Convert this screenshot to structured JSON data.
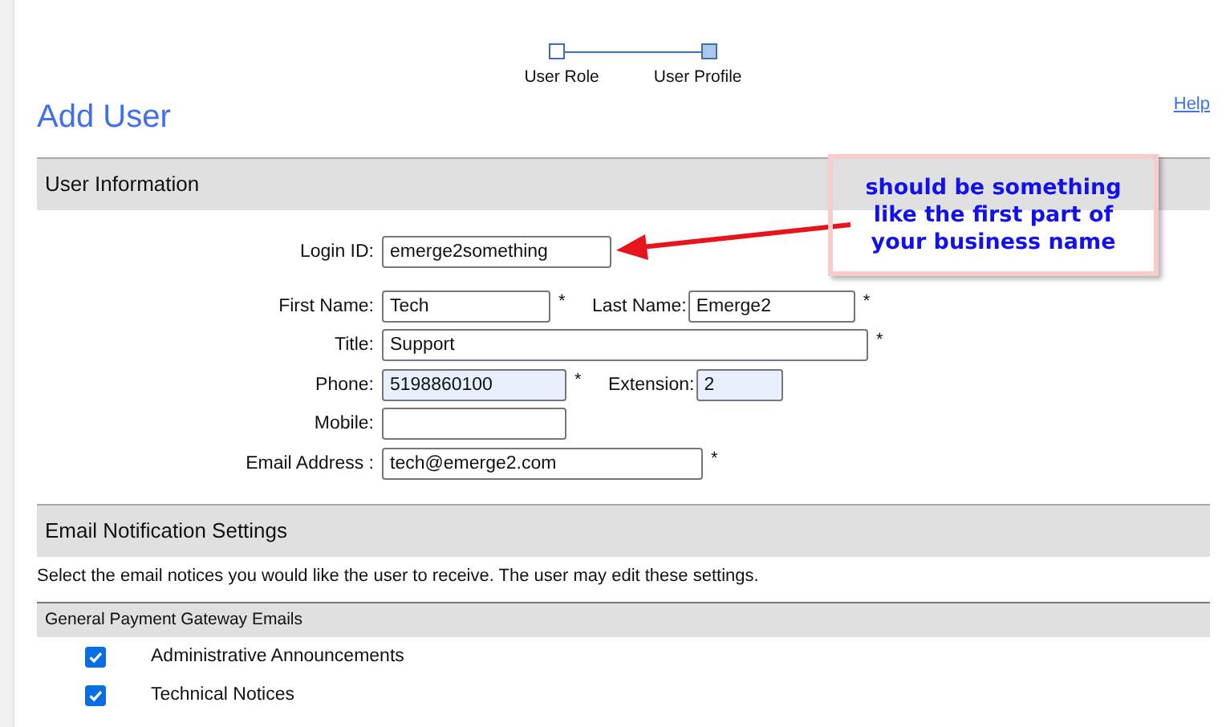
{
  "stepper": {
    "steps": [
      {
        "label": "User Role",
        "selected": false
      },
      {
        "label": "User Profile",
        "selected": true
      }
    ]
  },
  "title": "Add User",
  "help": "Help",
  "user_information": {
    "heading": "User Information",
    "rows": [
      [
        {
          "label": "Login ID:",
          "value": "emerge2something",
          "autofilled": false
        }
      ],
      [
        {
          "label": "First Name:",
          "value": "Tech",
          "required_mark": "*",
          "autofilled": false
        },
        {
          "label": "Last Name:",
          "value": "Emerge2",
          "required_mark": "*",
          "autofilled": false
        }
      ],
      [
        {
          "label": "Title:",
          "value": "Support",
          "required_mark": "*",
          "autofilled": false
        }
      ],
      [
        {
          "label": "Phone:",
          "value": "5198860100",
          "required_mark": "*",
          "autofilled": true
        },
        {
          "label": "Extension:",
          "value": "2",
          "autofilled": true
        }
      ],
      [
        {
          "label": "Mobile:",
          "autofilled": false
        }
      ],
      [
        {
          "label": "Email Address :",
          "value": "tech@emerge2.com",
          "required_mark": "*",
          "autofilled": false
        }
      ]
    ]
  },
  "email_notifications": {
    "heading": "Email Notification Settings",
    "description": "Select the email notices you would like the user to receive. The user may edit these settings.",
    "group": {
      "heading": "General Payment Gateway Emails",
      "items": [
        {
          "label": "Administrative Announcements",
          "checked": true
        },
        {
          "label": "Technical Notices",
          "checked": true
        }
      ]
    }
  },
  "callout": {
    "text": "should be something like the first part of your business name"
  }
}
